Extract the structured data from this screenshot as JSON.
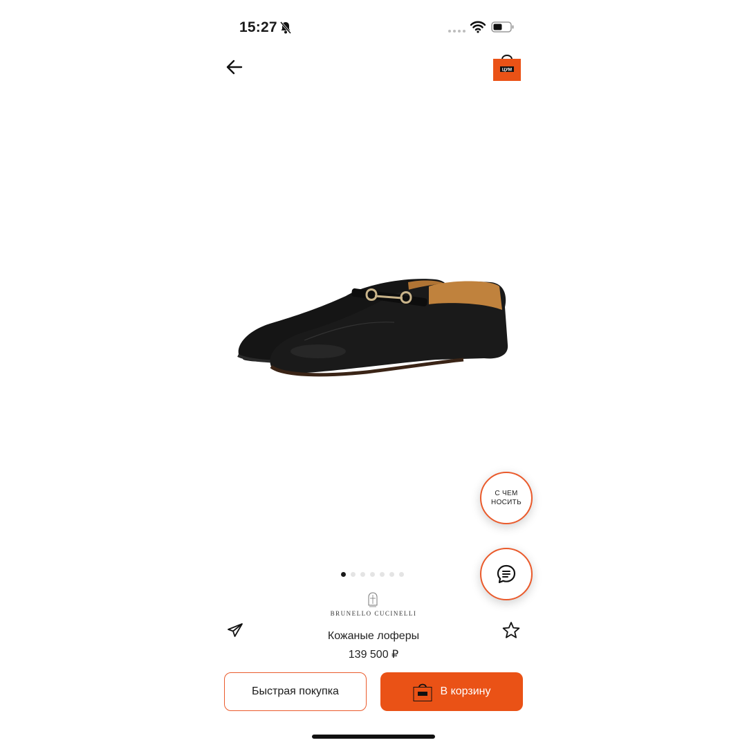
{
  "status_bar": {
    "time": "15:27",
    "icons": [
      "bell-slash-icon",
      "cellular-signal-icon",
      "wifi-icon",
      "battery-icon"
    ]
  },
  "header": {
    "back_icon": "arrow-left-icon",
    "logo_text": "ЦУМ"
  },
  "product": {
    "image": "black-leather-loafers",
    "gallery_count": 7,
    "gallery_active_index": 0,
    "brand": "BRUNELLO CUCINELLI",
    "title": "Кожаные лоферы",
    "price": "139 500 ₽"
  },
  "floating": {
    "wear_with_label": "С ЧЕМ\nНОСИТЬ",
    "chat_icon": "chat-bubble-icon"
  },
  "actions": {
    "share_icon": "paper-plane-icon",
    "favorite_icon": "star-outline-icon",
    "quick_buy_label": "Быстрая покупка",
    "add_to_cart_label": "В корзину"
  },
  "colors": {
    "accent": "#ea5216",
    "accent_border": "#ea5a2b",
    "text": "#1a1a1a"
  }
}
